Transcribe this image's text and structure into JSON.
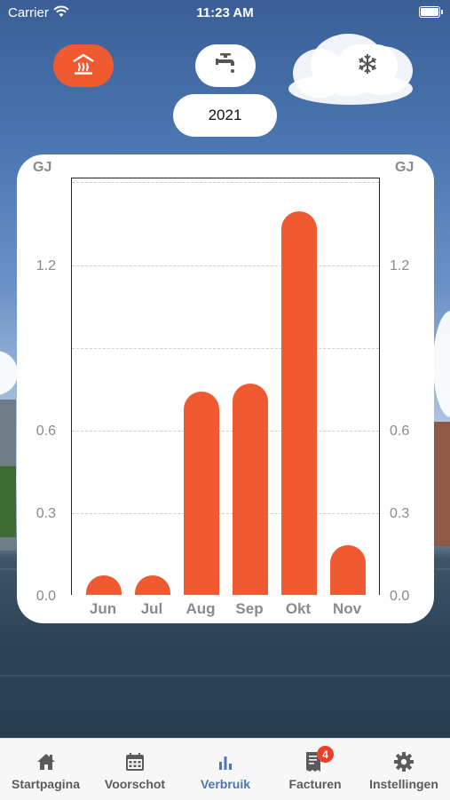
{
  "status_bar": {
    "carrier": "Carrier",
    "time": "11:23 AM"
  },
  "energy_types": [
    {
      "icon": "heating-icon",
      "active": true
    },
    {
      "icon": "tap-water-icon",
      "active": false
    },
    {
      "icon": "snowflake-icon",
      "active": false
    }
  ],
  "year_selector": {
    "label": "2021"
  },
  "chart_data": {
    "type": "bar",
    "unit_left": "GJ",
    "unit_right": "GJ",
    "y_ticks": [
      "1.2",
      "0.6",
      "0.3",
      "0.0"
    ],
    "categories": [
      "Jun",
      "Jul",
      "Aug",
      "Sep",
      "Okt",
      "Nov"
    ],
    "values": [
      0.07,
      0.07,
      0.73,
      0.76,
      1.38,
      0.18
    ],
    "ylim": [
      0,
      1.5
    ],
    "grid": true,
    "bar_color": "#f05a30"
  },
  "tab_bar": {
    "items": [
      {
        "label": "Startpagina",
        "icon": "home-icon",
        "active": false
      },
      {
        "label": "Voorschot",
        "icon": "calendar-icon",
        "active": false
      },
      {
        "label": "Verbruik",
        "icon": "bar-chart-icon",
        "active": true
      },
      {
        "label": "Facturen",
        "icon": "invoice-icon",
        "active": false,
        "badge": "4"
      },
      {
        "label": "Instellingen",
        "icon": "gear-icon",
        "active": false
      }
    ],
    "active_color": "#4a76b1"
  }
}
